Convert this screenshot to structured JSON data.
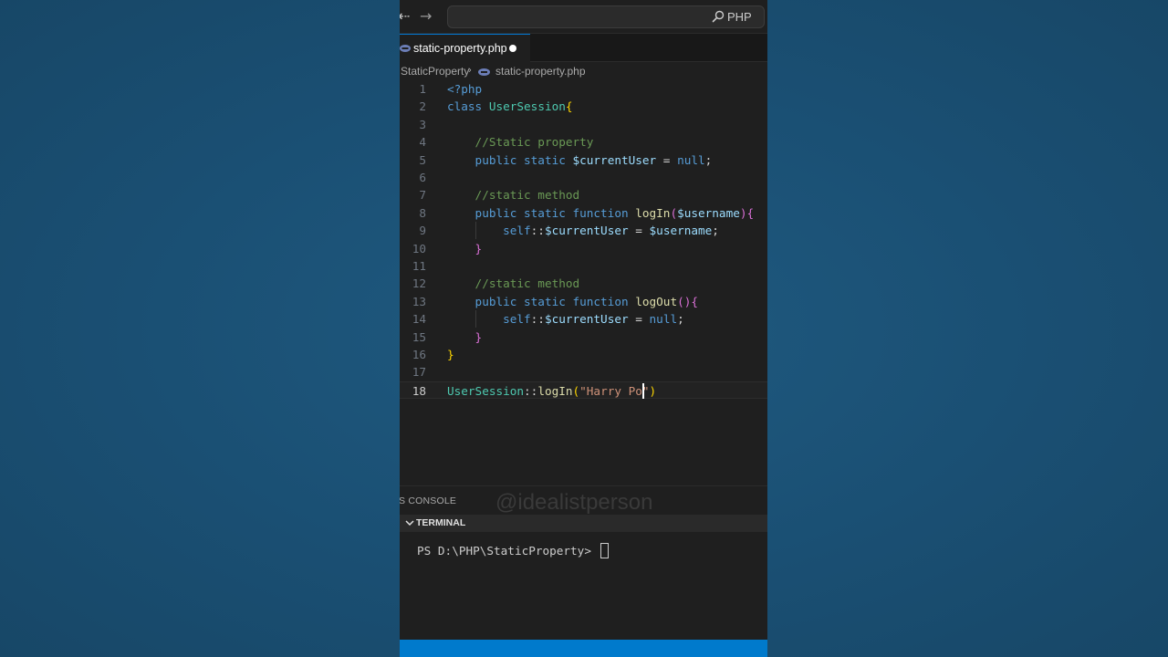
{
  "titlebar": {
    "back_icon": "arrow-left-icon",
    "forward_icon": "arrow-right-icon",
    "back_glyph": "⇠",
    "forward_glyph": "→",
    "search_label": "PHP"
  },
  "tab": {
    "label": "static-property.php",
    "icon": "php-file-icon",
    "modified_indicator": "dot-icon"
  },
  "breadcrumb": {
    "folder": "StaticProperty",
    "separator": "›",
    "file": "static-property.php"
  },
  "editor": {
    "active_line": 18,
    "lines": [
      {
        "n": "1",
        "tokens": [
          {
            "t": "<?php",
            "c": "#569cd6"
          }
        ]
      },
      {
        "n": "2",
        "tokens": [
          {
            "t": "class ",
            "c": "#569cd6"
          },
          {
            "t": "UserSession",
            "c": "#4ec9b0"
          },
          {
            "t": "{",
            "c": "#ffd700"
          }
        ]
      },
      {
        "n": "3",
        "tokens": []
      },
      {
        "n": "4",
        "tokens": [
          {
            "t": "    //Static property",
            "c": "#6a9955"
          }
        ]
      },
      {
        "n": "5",
        "tokens": [
          {
            "t": "    public static ",
            "c": "#569cd6"
          },
          {
            "t": "$currentUser",
            "c": "#9cdcfe"
          },
          {
            "t": " = ",
            "c": "#d4d4d4"
          },
          {
            "t": "null",
            "c": "#569cd6"
          },
          {
            "t": ";",
            "c": "#d4d4d4"
          }
        ]
      },
      {
        "n": "6",
        "tokens": []
      },
      {
        "n": "7",
        "tokens": [
          {
            "t": "    //static method",
            "c": "#6a9955"
          }
        ]
      },
      {
        "n": "8",
        "tokens": [
          {
            "t": "    public static function ",
            "c": "#569cd6"
          },
          {
            "t": "logIn",
            "c": "#dcdcaa"
          },
          {
            "t": "(",
            "c": "#da70d6"
          },
          {
            "t": "$username",
            "c": "#9cdcfe"
          },
          {
            "t": "){",
            "c": "#da70d6"
          }
        ]
      },
      {
        "n": "9",
        "tokens": [
          {
            "t": "        self",
            "c": "#569cd6"
          },
          {
            "t": "::",
            "c": "#d4d4d4"
          },
          {
            "t": "$currentUser",
            "c": "#9cdcfe"
          },
          {
            "t": " = ",
            "c": "#d4d4d4"
          },
          {
            "t": "$username",
            "c": "#9cdcfe"
          },
          {
            "t": ";",
            "c": "#d4d4d4"
          }
        ]
      },
      {
        "n": "10",
        "tokens": [
          {
            "t": "    }",
            "c": "#da70d6"
          }
        ]
      },
      {
        "n": "11",
        "tokens": []
      },
      {
        "n": "12",
        "tokens": [
          {
            "t": "    //static method",
            "c": "#6a9955"
          }
        ]
      },
      {
        "n": "13",
        "tokens": [
          {
            "t": "    public static function ",
            "c": "#569cd6"
          },
          {
            "t": "logOut",
            "c": "#dcdcaa"
          },
          {
            "t": "(){",
            "c": "#da70d6"
          }
        ]
      },
      {
        "n": "14",
        "tokens": [
          {
            "t": "        self",
            "c": "#569cd6"
          },
          {
            "t": "::",
            "c": "#d4d4d4"
          },
          {
            "t": "$currentUser",
            "c": "#9cdcfe"
          },
          {
            "t": " = ",
            "c": "#d4d4d4"
          },
          {
            "t": "null",
            "c": "#569cd6"
          },
          {
            "t": ";",
            "c": "#d4d4d4"
          }
        ]
      },
      {
        "n": "15",
        "tokens": [
          {
            "t": "    }",
            "c": "#da70d6"
          }
        ]
      },
      {
        "n": "16",
        "tokens": [
          {
            "t": "}",
            "c": "#ffd700"
          }
        ]
      },
      {
        "n": "17",
        "tokens": []
      },
      {
        "n": "18",
        "tokens": [
          {
            "t": "UserSession",
            "c": "#4ec9b0"
          },
          {
            "t": "::",
            "c": "#d4d4d4"
          },
          {
            "t": "logIn",
            "c": "#dcdcaa"
          },
          {
            "t": "(",
            "c": "#ffd700"
          },
          {
            "t": "\"Harry Po\"",
            "c": "#ce9178"
          },
          {
            "t": ")",
            "c": "#ffd700"
          }
        ]
      }
    ]
  },
  "panel": {
    "tab_label": "S CONSOLE",
    "watermark": "@idealistperson",
    "terminal_title": "TERMINAL",
    "prompt": "PS D:\\PHP\\StaticProperty> "
  },
  "colors": {
    "editor_bg": "#1f1f1f",
    "accent": "#007acc",
    "desktop_bg": "#1c5074"
  }
}
